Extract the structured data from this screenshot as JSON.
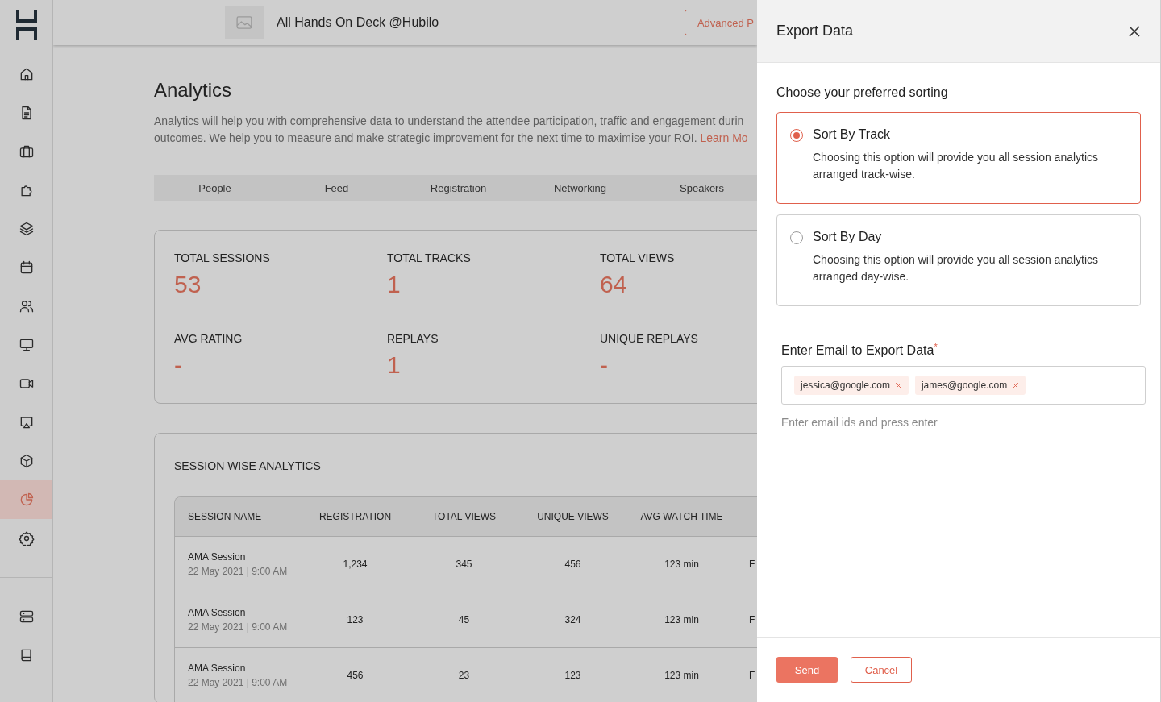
{
  "sidebar": {
    "items": [
      {
        "kind": "home",
        "selected": false
      },
      {
        "kind": "document",
        "selected": false
      },
      {
        "kind": "briefcase",
        "selected": false
      },
      {
        "kind": "puzzle",
        "selected": false
      },
      {
        "kind": "layers",
        "selected": false
      },
      {
        "kind": "calendar",
        "selected": false
      },
      {
        "kind": "users",
        "selected": false
      },
      {
        "kind": "monitor",
        "selected": false
      },
      {
        "kind": "video",
        "selected": false
      },
      {
        "kind": "cast",
        "selected": false
      },
      {
        "kind": "cube",
        "selected": false
      },
      {
        "kind": "pie",
        "selected": true
      },
      {
        "kind": "gear",
        "selected": false
      }
    ],
    "bottom_items": [
      {
        "kind": "server",
        "selected": false
      },
      {
        "kind": "book",
        "selected": false
      }
    ]
  },
  "header": {
    "event_title": "All Hands On Deck @Hubilo",
    "advanced_button": "Advanced P"
  },
  "page": {
    "title": "Analytics",
    "description_lines": [
      "Analytics will help you with comprehensive data to understand the attendee participation, traffic and engagement durin",
      "outcomes. We help you to measure and make strategic improvement for the next time to maximise your ROI."
    ],
    "learn_more_link": "Learn Mo",
    "tabs": [
      {
        "label": "People",
        "selected": false
      },
      {
        "label": "Feed",
        "selected": false
      },
      {
        "label": "Registration",
        "selected": false
      },
      {
        "label": "Networking",
        "selected": false
      },
      {
        "label": "Speakers",
        "selected": false
      }
    ],
    "stats": [
      {
        "label": "TOTAL SESSIONS",
        "value": "53"
      },
      {
        "label": "TOTAL TRACKS",
        "value": "1"
      },
      {
        "label": "TOTAL VIEWS",
        "value": "64"
      },
      {
        "label": "AVG RATING",
        "value": "-"
      },
      {
        "label": "REPLAYS",
        "value": "1"
      },
      {
        "label": "UNIQUE REPLAYS",
        "value": "-"
      }
    ],
    "session_table": {
      "title": "SESSION WISE ANALYTICS",
      "columns": [
        "SESSION NAME",
        "REGISTRATION",
        "TOTAL VIEWS",
        "UNIQUE VIEWS",
        "AVG WATCH TIME"
      ],
      "rows": [
        {
          "name": "AMA Session",
          "date": "22 May 2021 | 9:00 AM",
          "registration": "1,234",
          "total_views": "345",
          "unique_views": "456",
          "avg_watch_time": "123 min",
          "column_6": "F"
        },
        {
          "name": "AMA Session",
          "date": "22 May 2021 | 9:00 AM",
          "registration": "123",
          "total_views": "45",
          "unique_views": "324",
          "avg_watch_time": "123 min",
          "column_6": "F"
        },
        {
          "name": "AMA Session",
          "date": "22 May 2021 | 9:00 AM",
          "registration": "456",
          "total_views": "23",
          "unique_views": "123",
          "avg_watch_time": "123 min",
          "column_6": "F"
        }
      ]
    }
  },
  "export_panel": {
    "title": "Export Data",
    "sorting_label": "Choose your preferred sorting",
    "options": [
      {
        "title": "Sort By Track",
        "description": "Choosing this option will provide you all session analytics arranged track-wise.",
        "selected": true
      },
      {
        "title": "Sort By Day",
        "description": "Choosing this option will provide you all session analytics arranged day-wise.",
        "selected": false
      }
    ],
    "email_label": "Enter Email to Export Data",
    "required_mark": "*",
    "emails": [
      "jessica@google.com",
      "james@google.com"
    ],
    "email_hint": "Enter email ids and press enter",
    "buttons": [
      {
        "kind": "primary",
        "label": "Send"
      },
      {
        "kind": "secondary",
        "label": "Cancel"
      }
    ]
  }
}
